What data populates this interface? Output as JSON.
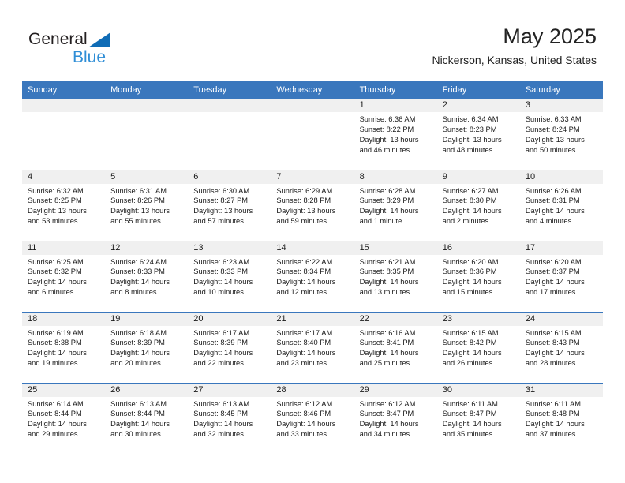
{
  "brand": {
    "name_part1": "General",
    "name_part2": "Blue",
    "triangle_color": "#0f6cb6",
    "text_color_primary": "#231f20",
    "text_color_secondary": "#2f8ed6"
  },
  "header": {
    "title": "May 2025",
    "subtitle": "Nickerson, Kansas, United States"
  },
  "theme": {
    "header_blue": "#3a77bd",
    "daynum_band": "#f0f0f0",
    "page_background": "#ffffff",
    "text": "#1a1a1a"
  },
  "calendar": {
    "weekday_headers": [
      "Sunday",
      "Monday",
      "Tuesday",
      "Wednesday",
      "Thursday",
      "Friday",
      "Saturday"
    ],
    "weeks": [
      [
        {
          "day": "",
          "empty": true,
          "lines": []
        },
        {
          "day": "",
          "empty": true,
          "lines": []
        },
        {
          "day": "",
          "empty": true,
          "lines": []
        },
        {
          "day": "",
          "empty": true,
          "lines": []
        },
        {
          "day": "1",
          "empty": false,
          "lines": [
            "Sunrise: 6:36 AM",
            "Sunset: 8:22 PM",
            "Daylight: 13 hours and 46 minutes."
          ]
        },
        {
          "day": "2",
          "empty": false,
          "lines": [
            "Sunrise: 6:34 AM",
            "Sunset: 8:23 PM",
            "Daylight: 13 hours and 48 minutes."
          ]
        },
        {
          "day": "3",
          "empty": false,
          "lines": [
            "Sunrise: 6:33 AM",
            "Sunset: 8:24 PM",
            "Daylight: 13 hours and 50 minutes."
          ]
        }
      ],
      [
        {
          "day": "4",
          "empty": false,
          "lines": [
            "Sunrise: 6:32 AM",
            "Sunset: 8:25 PM",
            "Daylight: 13 hours and 53 minutes."
          ]
        },
        {
          "day": "5",
          "empty": false,
          "lines": [
            "Sunrise: 6:31 AM",
            "Sunset: 8:26 PM",
            "Daylight: 13 hours and 55 minutes."
          ]
        },
        {
          "day": "6",
          "empty": false,
          "lines": [
            "Sunrise: 6:30 AM",
            "Sunset: 8:27 PM",
            "Daylight: 13 hours and 57 minutes."
          ]
        },
        {
          "day": "7",
          "empty": false,
          "lines": [
            "Sunrise: 6:29 AM",
            "Sunset: 8:28 PM",
            "Daylight: 13 hours and 59 minutes."
          ]
        },
        {
          "day": "8",
          "empty": false,
          "lines": [
            "Sunrise: 6:28 AM",
            "Sunset: 8:29 PM",
            "Daylight: 14 hours and 1 minute."
          ]
        },
        {
          "day": "9",
          "empty": false,
          "lines": [
            "Sunrise: 6:27 AM",
            "Sunset: 8:30 PM",
            "Daylight: 14 hours and 2 minutes."
          ]
        },
        {
          "day": "10",
          "empty": false,
          "lines": [
            "Sunrise: 6:26 AM",
            "Sunset: 8:31 PM",
            "Daylight: 14 hours and 4 minutes."
          ]
        }
      ],
      [
        {
          "day": "11",
          "empty": false,
          "lines": [
            "Sunrise: 6:25 AM",
            "Sunset: 8:32 PM",
            "Daylight: 14 hours and 6 minutes."
          ]
        },
        {
          "day": "12",
          "empty": false,
          "lines": [
            "Sunrise: 6:24 AM",
            "Sunset: 8:33 PM",
            "Daylight: 14 hours and 8 minutes."
          ]
        },
        {
          "day": "13",
          "empty": false,
          "lines": [
            "Sunrise: 6:23 AM",
            "Sunset: 8:33 PM",
            "Daylight: 14 hours and 10 minutes."
          ]
        },
        {
          "day": "14",
          "empty": false,
          "lines": [
            "Sunrise: 6:22 AM",
            "Sunset: 8:34 PM",
            "Daylight: 14 hours and 12 minutes."
          ]
        },
        {
          "day": "15",
          "empty": false,
          "lines": [
            "Sunrise: 6:21 AM",
            "Sunset: 8:35 PM",
            "Daylight: 14 hours and 13 minutes."
          ]
        },
        {
          "day": "16",
          "empty": false,
          "lines": [
            "Sunrise: 6:20 AM",
            "Sunset: 8:36 PM",
            "Daylight: 14 hours and 15 minutes."
          ]
        },
        {
          "day": "17",
          "empty": false,
          "lines": [
            "Sunrise: 6:20 AM",
            "Sunset: 8:37 PM",
            "Daylight: 14 hours and 17 minutes."
          ]
        }
      ],
      [
        {
          "day": "18",
          "empty": false,
          "lines": [
            "Sunrise: 6:19 AM",
            "Sunset: 8:38 PM",
            "Daylight: 14 hours and 19 minutes."
          ]
        },
        {
          "day": "19",
          "empty": false,
          "lines": [
            "Sunrise: 6:18 AM",
            "Sunset: 8:39 PM",
            "Daylight: 14 hours and 20 minutes."
          ]
        },
        {
          "day": "20",
          "empty": false,
          "lines": [
            "Sunrise: 6:17 AM",
            "Sunset: 8:39 PM",
            "Daylight: 14 hours and 22 minutes."
          ]
        },
        {
          "day": "21",
          "empty": false,
          "lines": [
            "Sunrise: 6:17 AM",
            "Sunset: 8:40 PM",
            "Daylight: 14 hours and 23 minutes."
          ]
        },
        {
          "day": "22",
          "empty": false,
          "lines": [
            "Sunrise: 6:16 AM",
            "Sunset: 8:41 PM",
            "Daylight: 14 hours and 25 minutes."
          ]
        },
        {
          "day": "23",
          "empty": false,
          "lines": [
            "Sunrise: 6:15 AM",
            "Sunset: 8:42 PM",
            "Daylight: 14 hours and 26 minutes."
          ]
        },
        {
          "day": "24",
          "empty": false,
          "lines": [
            "Sunrise: 6:15 AM",
            "Sunset: 8:43 PM",
            "Daylight: 14 hours and 28 minutes."
          ]
        }
      ],
      [
        {
          "day": "25",
          "empty": false,
          "lines": [
            "Sunrise: 6:14 AM",
            "Sunset: 8:44 PM",
            "Daylight: 14 hours and 29 minutes."
          ]
        },
        {
          "day": "26",
          "empty": false,
          "lines": [
            "Sunrise: 6:13 AM",
            "Sunset: 8:44 PM",
            "Daylight: 14 hours and 30 minutes."
          ]
        },
        {
          "day": "27",
          "empty": false,
          "lines": [
            "Sunrise: 6:13 AM",
            "Sunset: 8:45 PM",
            "Daylight: 14 hours and 32 minutes."
          ]
        },
        {
          "day": "28",
          "empty": false,
          "lines": [
            "Sunrise: 6:12 AM",
            "Sunset: 8:46 PM",
            "Daylight: 14 hours and 33 minutes."
          ]
        },
        {
          "day": "29",
          "empty": false,
          "lines": [
            "Sunrise: 6:12 AM",
            "Sunset: 8:47 PM",
            "Daylight: 14 hours and 34 minutes."
          ]
        },
        {
          "day": "30",
          "empty": false,
          "lines": [
            "Sunrise: 6:11 AM",
            "Sunset: 8:47 PM",
            "Daylight: 14 hours and 35 minutes."
          ]
        },
        {
          "day": "31",
          "empty": false,
          "lines": [
            "Sunrise: 6:11 AM",
            "Sunset: 8:48 PM",
            "Daylight: 14 hours and 37 minutes."
          ]
        }
      ]
    ]
  }
}
